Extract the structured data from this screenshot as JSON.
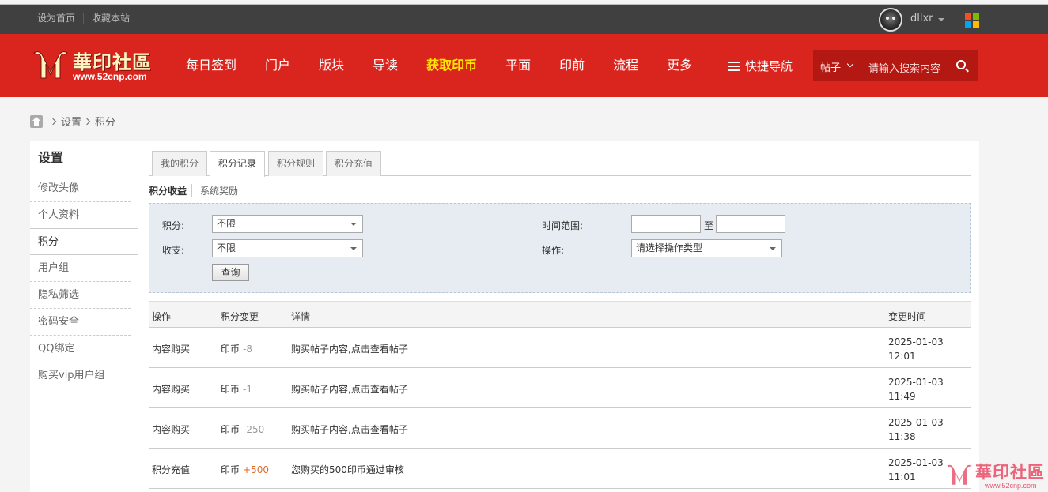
{
  "topbar": {
    "links": [
      "设为首页",
      "收藏本站"
    ],
    "username": "dllxr"
  },
  "colors": {
    "header_red": "#d9251d",
    "highlight_yellow": "#ffe600",
    "windows_icon": [
      "#f25022",
      "#7fba00",
      "#00a4ef",
      "#ffb900"
    ]
  },
  "logo": {
    "cn": "華印社區",
    "url": "www.52cnp.com"
  },
  "nav": {
    "items": [
      "每日签到",
      "门户",
      "版块",
      "导读",
      "获取印币",
      "平面",
      "印前",
      "流程",
      "更多"
    ],
    "highlight_index": 4,
    "quick_nav": "快捷导航"
  },
  "search": {
    "type": "帖子",
    "placeholder": "请输入搜索内容"
  },
  "breadcrumb": [
    "设置",
    "积分"
  ],
  "sidebar": {
    "title": "设置",
    "items": [
      "修改头像",
      "个人资料",
      "积分",
      "用户组",
      "隐私筛选",
      "密码安全",
      "QQ绑定",
      "购买vip用户组"
    ],
    "active_index": 2
  },
  "tabs": [
    "我的积分",
    "积分记录",
    "积分规则",
    "积分充值"
  ],
  "active_tab": 1,
  "subtabs": [
    "积分收益",
    "系统奖励"
  ],
  "filter": {
    "credit_label": "积分:",
    "credit_value": "不限",
    "inout_label": "收支:",
    "inout_value": "不限",
    "time_label": "时间范围:",
    "to": "至",
    "op_label": "操作:",
    "op_value": "请选择操作类型",
    "query_button": "查询"
  },
  "table": {
    "headers": [
      "操作",
      "积分变更",
      "详情",
      "变更时间"
    ],
    "rows": [
      {
        "op": "内容购买",
        "currency": "印币",
        "change": "-8",
        "detail": "购买帖子内容,点击查看帖子",
        "date": "2025-01-03",
        "time": "12:01"
      },
      {
        "op": "内容购买",
        "currency": "印币",
        "change": "-1",
        "detail": "购买帖子内容,点击查看帖子",
        "date": "2025-01-03",
        "time": "11:49"
      },
      {
        "op": "内容购买",
        "currency": "印币",
        "change": "-250",
        "detail": "购买帖子内容,点击查看帖子",
        "date": "2025-01-03",
        "time": "11:38"
      },
      {
        "op": "积分充值",
        "currency": "印币",
        "change": "+500",
        "detail": "您购买的500印币通过审核",
        "date": "2025-01-03",
        "time": "11:01"
      }
    ]
  },
  "watermark": {
    "cn": "華印社區",
    "url": "www.52cnp.com"
  }
}
